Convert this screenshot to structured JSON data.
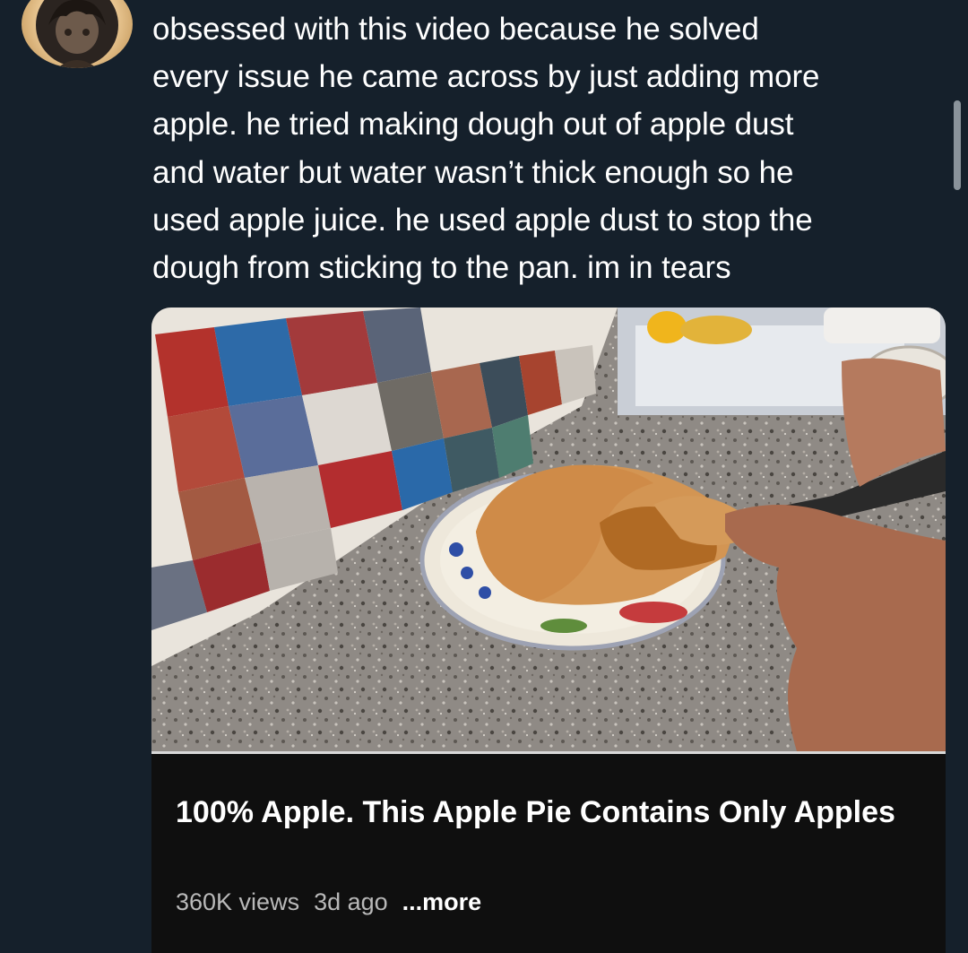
{
  "tweet": {
    "text": "obsessed with this video because he solved\nevery issue he came across by just adding more\napple. he tried making dough out of apple dust\nand water but water wasn’t thick enough so he\nused apple juice. he used apple dust to stop the\ndough from sticking to the pan. im in tears"
  },
  "video": {
    "title": "100% Apple. This Apple Pie Contains Only Apples",
    "views": "360K views",
    "age": "3d ago",
    "more_label": "...more"
  },
  "colors": {
    "background": "#15202b",
    "card": "#0f0f0f",
    "text": "#ffffff",
    "meta": "#b9b9b9"
  }
}
